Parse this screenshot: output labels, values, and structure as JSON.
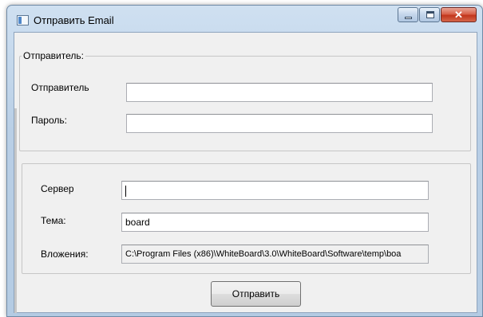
{
  "window": {
    "title": "Отправить Email",
    "buttons": {
      "close": "✕"
    }
  },
  "sender_group": {
    "legend": "Отправитель:",
    "sender_label": "Отправитель",
    "sender_value": "",
    "password_label": "Пароль:",
    "password_value": ""
  },
  "mail_group": {
    "server_label": "Сервер",
    "server_value": "",
    "subject_label": "Тема:",
    "subject_value": "board",
    "attachments_label": "Вложения:",
    "attachments_value": "C:\\Program Files (x86)\\WhiteBoard\\3.0\\WhiteBoard\\Software\\temp\\boa"
  },
  "send_button": "Отправить",
  "colors": {
    "client_bg": "#f0f0f0",
    "frame": "#b9cfe6",
    "close_button": "#c2361c"
  }
}
